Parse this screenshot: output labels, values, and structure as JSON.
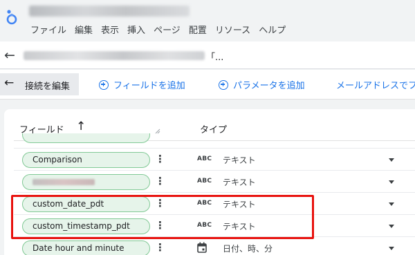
{
  "colors": {
    "accent": "#1a73e8",
    "pill_bg": "#e6f4ea",
    "pill_border": "#81c995",
    "highlight": "#e8110d"
  },
  "menu": [
    "ファイル",
    "編集",
    "表示",
    "挿入",
    "ページ",
    "配置",
    "リソース",
    "ヘルプ"
  ],
  "url_tail": "「...",
  "toolbar": {
    "edit_label": "接続を編集",
    "add_field": "フィールドを追加",
    "add_param": "パラメータを追加",
    "email": "メールアドレスでフ"
  },
  "table": {
    "header_field": "フィールド",
    "header_type": "タイプ",
    "rows": [
      {
        "name": "Comparison",
        "type_icon": "ABC",
        "type": "テキスト"
      },
      {
        "name": "",
        "type_icon": "ABC",
        "type": "テキスト"
      },
      {
        "name": "custom_date_pdt",
        "type_icon": "ABC",
        "type": "テキスト"
      },
      {
        "name": "custom_timestamp_pdt",
        "type_icon": "ABC",
        "type": "テキスト"
      },
      {
        "name": "Date hour and minute",
        "type_icon": "calendar-icon",
        "type": "日付、時、分"
      }
    ]
  }
}
